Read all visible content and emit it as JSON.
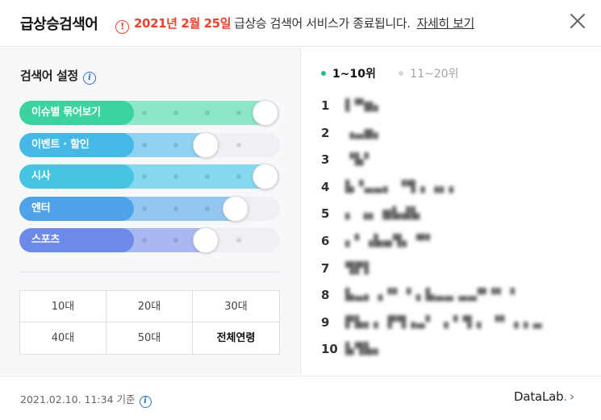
{
  "header": {
    "title": "급상승검색어",
    "notice_icon": "alert-circle-icon",
    "notice_date": "2021년 2월 25일",
    "notice_text": "급상승 검색어 서비스가 종료됩니다.",
    "notice_link": "자세히 보기",
    "close_icon": "close-icon"
  },
  "settings": {
    "title": "검색어 설정",
    "info_icon": "info-icon",
    "sliders": [
      {
        "label": "이슈별 묶어보기",
        "level": 4,
        "max": 4,
        "color": "#3bd3a0",
        "fill_color": "#8de6c8"
      },
      {
        "label": "이벤트 · 할인",
        "level": 2,
        "max": 4,
        "color": "#45b8e6",
        "fill_color": "#8fd2f1"
      },
      {
        "label": "시사",
        "level": 4,
        "max": 4,
        "color": "#46c5e3",
        "fill_color": "#86d8ef"
      },
      {
        "label": "엔터",
        "level": 3,
        "max": 4,
        "color": "#4fa3e8",
        "fill_color": "#93c7f2"
      },
      {
        "label": "스포츠",
        "level": 2,
        "max": 4,
        "color": "#6d8ae8",
        "fill_color": "#a9b8f1"
      }
    ],
    "ages": [
      "10대",
      "20대",
      "30대",
      "40대",
      "50대",
      "전체연령"
    ],
    "selected_age": "전체연령"
  },
  "ranking": {
    "tabs": [
      {
        "label": "1~10위",
        "active": true
      },
      {
        "label": "11~20위",
        "active": false
      }
    ],
    "items": [
      {
        "rank": "1",
        "keyword": "▌▀▆▖"
      },
      {
        "rank": "2",
        "keyword": "▗▃▆▖"
      },
      {
        "rank": "3",
        "keyword": "▝▙▘"
      },
      {
        "rank": "4",
        "keyword": "▙▝▃▃▖ ▝▜▗ ▗▖▖"
      },
      {
        "rank": "5",
        "keyword": "  ▖ ▗▖ ▆▙▟▙"
      },
      {
        "rank": "6",
        "keyword": "▖▘▗▙▄▜▖ ▀▘"
      },
      {
        "rank": "7",
        "keyword": "▜▛▌"
      },
      {
        "rank": "8",
        "keyword": "▙▃▖▗▝▘ ▘▖▙▃▃ ▃▃▀▝▘ ▘"
      },
      {
        "rank": "9",
        "keyword": "▛▙▖▖ ▛▜▗▃▘ ▗ ▘▜ ▖  ▝▘▗ ▖▃"
      },
      {
        "rank": "10",
        "keyword": "▙▜▙▖"
      }
    ]
  },
  "footer": {
    "timestamp": "2021.02.10. 11:34 기준",
    "info_icon": "info-icon",
    "brand_name": "DataLab",
    "brand_dot": ".",
    "brand_chevron": "›"
  }
}
